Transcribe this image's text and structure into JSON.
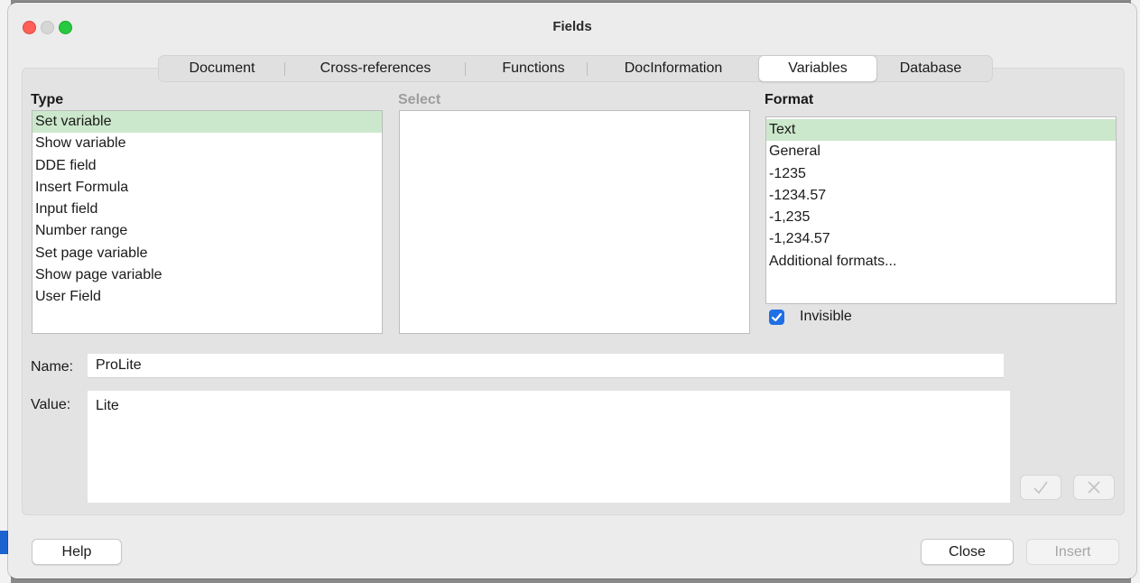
{
  "window": {
    "title": "Fields"
  },
  "tabs": [
    {
      "label": "Document"
    },
    {
      "label": "Cross-references"
    },
    {
      "label": "Functions"
    },
    {
      "label": "DocInformation"
    },
    {
      "label": "Variables",
      "active": true
    },
    {
      "label": "Database"
    }
  ],
  "type_list": {
    "heading": "Type",
    "items": [
      "Set variable",
      "Show variable",
      "DDE field",
      "Insert Formula",
      "Input field",
      "Number range",
      "Set page variable",
      "Show page variable",
      "User Field"
    ],
    "selected": "Set variable"
  },
  "select_list": {
    "heading": "Select"
  },
  "format_list": {
    "heading": "Format",
    "items": [
      "Text",
      "General",
      "-1235",
      "-1234.57",
      "-1,235",
      "-1,234.57",
      "Additional formats..."
    ],
    "selected": "Text"
  },
  "invisible": {
    "label": "Invisible",
    "checked": true
  },
  "name_field": {
    "label": "Name:",
    "value": "ProLite"
  },
  "value_field": {
    "label": "Value:",
    "value": "Lite"
  },
  "edit_buttons": {
    "apply_icon": "checkmark-icon",
    "clear_icon": "x-icon"
  },
  "buttons": {
    "help": "Help",
    "close": "Close",
    "insert": "Insert"
  },
  "colors": {
    "selection": "#cce8cc",
    "checkbox": "#1f6fe5",
    "close_dot": "#fe5f57",
    "max_dot": "#28c840"
  }
}
